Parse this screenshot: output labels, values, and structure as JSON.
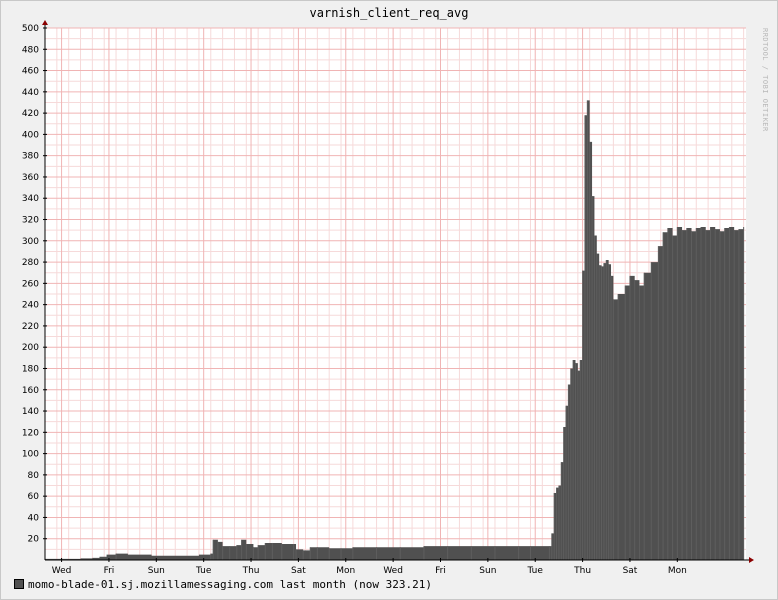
{
  "chart_data": {
    "type": "area",
    "title": "varnish_client_req_avg",
    "watermark": "RRDTOOL / TOBI OETIKER",
    "ylim": [
      0,
      500
    ],
    "y_ticks": [
      20,
      40,
      60,
      80,
      100,
      120,
      140,
      160,
      180,
      200,
      220,
      240,
      260,
      280,
      300,
      320,
      340,
      360,
      380,
      400,
      420,
      440,
      460,
      480,
      500
    ],
    "x_tick_labels": [
      "Wed",
      "Fri",
      "Sun",
      "Tue",
      "Thu",
      "Sat",
      "Mon",
      "Wed",
      "Fri",
      "Sun",
      "Tue",
      "Thu",
      "Sat",
      "Mon"
    ],
    "x_range_days": [
      0,
      29.6
    ],
    "x_label_days": [
      0.7,
      2.7,
      4.7,
      6.7,
      8.7,
      10.7,
      12.7,
      14.7,
      16.7,
      18.7,
      20.7,
      22.7,
      24.7,
      26.7
    ],
    "grid": true,
    "legend_position": "bottom-left",
    "colors": {
      "area": "#505050",
      "grid": "#f0b4b4",
      "axis": "#000000",
      "arrow": "#8b0000"
    },
    "series": [
      {
        "name": "momo-blade-01.sj.mozillamessaging.com",
        "x": [
          0,
          0.5,
          1,
          1.5,
          2,
          2.3,
          2.6,
          3,
          3.5,
          4,
          4.5,
          5,
          5.5,
          6,
          6.5,
          7,
          7.1,
          7.3,
          7.5,
          7.8,
          8.1,
          8.3,
          8.5,
          8.8,
          9,
          9.3,
          9.6,
          10,
          10.5,
          10.6,
          10.9,
          11.2,
          11.5,
          12,
          12.5,
          13,
          14,
          15,
          16,
          17,
          18,
          19,
          20,
          20.5,
          21.3,
          21.4,
          21.5,
          21.6,
          21.7,
          21.8,
          21.9,
          22.0,
          22.1,
          22.2,
          22.3,
          22.4,
          22.5,
          22.6,
          22.7,
          22.8,
          22.9,
          23.0,
          23.1,
          23.2,
          23.3,
          23.4,
          23.5,
          23.6,
          23.7,
          23.8,
          23.9,
          24.0,
          24.2,
          24.5,
          24.7,
          24.9,
          25.1,
          25.3,
          25.6,
          25.9,
          26.1,
          26.3,
          26.5,
          26.7,
          26.9,
          27.1,
          27.3,
          27.5,
          27.7,
          27.9,
          28.1,
          28.3,
          28.5,
          28.7,
          28.9,
          29.1,
          29.3,
          29.5
        ],
        "y": [
          1,
          1,
          1,
          1.5,
          2,
          3,
          5,
          6,
          5,
          5,
          4,
          4,
          4,
          4,
          5,
          6,
          19,
          17,
          13,
          13,
          14,
          19,
          15,
          12,
          14,
          16,
          16,
          15,
          15,
          10,
          9,
          12,
          12,
          11,
          11,
          12,
          12,
          12,
          13,
          13,
          13,
          13,
          13,
          13,
          13,
          25,
          63,
          68,
          70,
          92,
          125,
          145,
          165,
          180,
          188,
          185,
          178,
          188,
          272,
          418,
          432,
          393,
          342,
          305,
          288,
          277,
          276,
          279,
          282,
          278,
          267,
          245,
          250,
          258,
          267,
          263,
          258,
          270,
          280,
          295,
          308,
          312,
          305,
          313,
          310,
          312,
          309,
          312,
          313,
          310,
          313,
          311,
          309,
          312,
          313,
          310,
          311,
          313
        ]
      }
    ],
    "legend_text": "momo-blade-01.sj.mozillamessaging.com last month (now 323.21)"
  }
}
